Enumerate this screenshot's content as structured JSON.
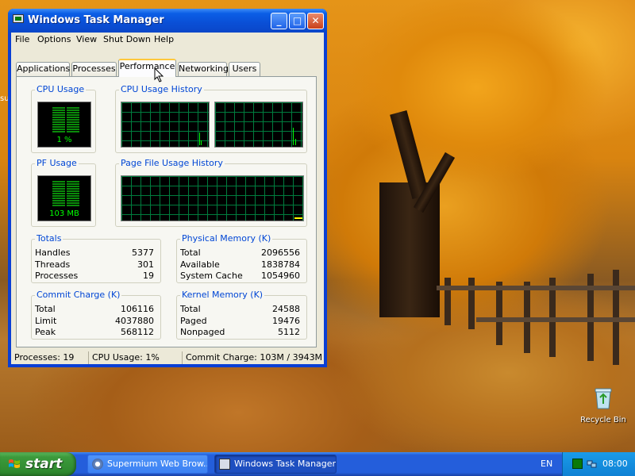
{
  "desktop": {
    "left_edge_text": "su",
    "icons": [
      {
        "label": "Recycle Bin",
        "icon": "recycle-bin-icon"
      }
    ]
  },
  "window": {
    "title": "Windows Task Manager",
    "icon": "task-manager-icon",
    "buttons": {
      "minimize": "_",
      "maximize": "□",
      "close": "✕"
    },
    "menu": [
      "File",
      "Options",
      "View",
      "Shut Down",
      "Help"
    ],
    "tabs": [
      "Applications",
      "Processes",
      "Performance",
      "Networking",
      "Users"
    ],
    "active_tab": "Performance",
    "performance": {
      "cpu_usage": {
        "label": "CPU Usage",
        "value": "1 %",
        "level": 0.01
      },
      "cpu_history": {
        "label": "CPU Usage History"
      },
      "pf_usage": {
        "label": "PF Usage",
        "value": "103 MB",
        "level": 0.03
      },
      "pf_history": {
        "label": "Page File Usage History"
      },
      "totals": {
        "label": "Totals",
        "rows": [
          {
            "k": "Handles",
            "v": "5377"
          },
          {
            "k": "Threads",
            "v": "301"
          },
          {
            "k": "Processes",
            "v": "19"
          }
        ]
      },
      "physical_memory": {
        "label": "Physical Memory (K)",
        "rows": [
          {
            "k": "Total",
            "v": "2096556"
          },
          {
            "k": "Available",
            "v": "1838784"
          },
          {
            "k": "System Cache",
            "v": "1054960"
          }
        ]
      },
      "commit_charge": {
        "label": "Commit Charge (K)",
        "rows": [
          {
            "k": "Total",
            "v": "106116"
          },
          {
            "k": "Limit",
            "v": "4037880"
          },
          {
            "k": "Peak",
            "v": "568112"
          }
        ]
      },
      "kernel_memory": {
        "label": "Kernel Memory (K)",
        "rows": [
          {
            "k": "Total",
            "v": "24588"
          },
          {
            "k": "Paged",
            "v": "19476"
          },
          {
            "k": "Nonpaged",
            "v": "5112"
          }
        ]
      }
    },
    "status": {
      "processes": "Processes: 19",
      "cpu": "CPU Usage: 1%",
      "commit": "Commit Charge: 103M / 3943M"
    }
  },
  "taskbar": {
    "start_label": "start",
    "tasks": [
      {
        "label": "Supermium Web Brow...",
        "icon": "browser-icon",
        "active": false
      },
      {
        "label": "Windows Task Manager",
        "icon": "task-manager-icon",
        "active": true
      }
    ],
    "language": "EN",
    "clock": "08:00",
    "tray_icons": [
      "task-manager-tray-icon",
      "network-tray-icon"
    ]
  },
  "colors": {
    "xp_blue": "#0a3fd4",
    "group_label": "#0046d5",
    "graph_grid": "#007d3e",
    "graph_line": "#00ff00",
    "start_green": "#3c9a3c"
  }
}
